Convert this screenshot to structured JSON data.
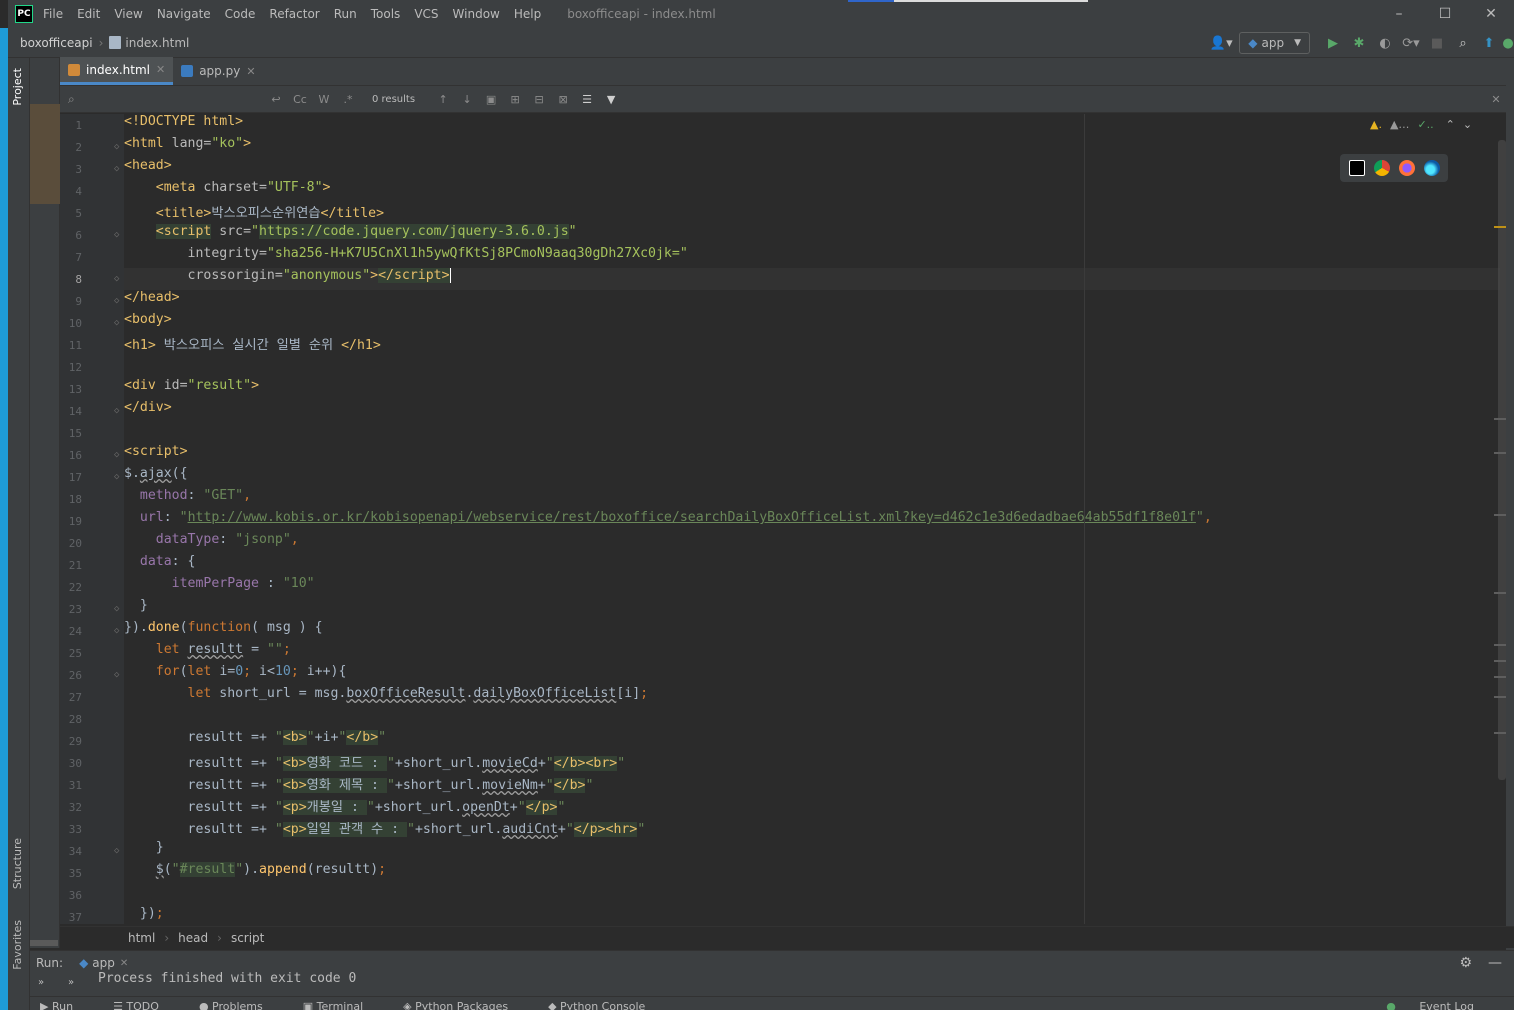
{
  "titlebar": {
    "logo": "PC",
    "menu": [
      "File",
      "Edit",
      "View",
      "Navigate",
      "Code",
      "Refactor",
      "Run",
      "Tools",
      "VCS",
      "Window",
      "Help"
    ],
    "window_title": "boxofficeapi - index.html",
    "controls": [
      "–",
      "☐",
      "✕"
    ]
  },
  "navbar": {
    "project": "boxofficeapi",
    "file": "index.html",
    "run_config": "app"
  },
  "left_tabs": {
    "project": "Project",
    "structure": "Structure",
    "favorites": "Favorites"
  },
  "tabs": [
    {
      "label": "index.html",
      "active": true
    },
    {
      "label": "app.py",
      "active": false
    }
  ],
  "findbar": {
    "placeholder": "",
    "case_label": "Cc",
    "word_label": "W",
    "regex_label": ".*",
    "results": "0 results"
  },
  "editor": {
    "line_numbers": [
      "1",
      "2",
      "3",
      "4",
      "5",
      "6",
      "7",
      "8",
      "9",
      "10",
      "11",
      "12",
      "13",
      "14",
      "15",
      "16",
      "17",
      "18",
      "19",
      "20",
      "21",
      "22",
      "23",
      "24",
      "25",
      "26",
      "27",
      "28",
      "29",
      "30",
      "31",
      "32",
      "33",
      "34",
      "35",
      "36",
      "37"
    ],
    "current_line": 8,
    "inspection": {
      "warnings_a": "▲.",
      "warnings_b": "▲…",
      "ok": "✓.."
    }
  },
  "code_text": {
    "l11_text": " 박스오피스 실시간 일별 순위 ",
    "l5_title": "박스오피스순위연습",
    "script_url": "https://code.jquery.com/jquery-3.6.0.js",
    "integrity": "sha256-H+K7U5CnXl1h5ywQfKtSj8PCmoN9aaq30gDh27Xc0jk=",
    "api_url": "http://www.kobis.or.kr/kobisopenapi/webservice/rest/boxoffice/searchDailyBoxOfficeList.xml?key=d462c1e3d6edadbae64ab55df1f8e01f",
    "label_code": "영화 코드 : ",
    "label_title": "영화 제목 : ",
    "label_open": "개봉일 : ",
    "label_audi": "일일 관객 수 : "
  },
  "editor_crumbs": [
    "html",
    "head",
    "script"
  ],
  "run_panel": {
    "label": "Run:",
    "tab": "app",
    "output": "Process finished with exit code 0"
  },
  "bottom_tools": [
    "Run",
    "TODO",
    "Problems",
    "Terminal",
    "Python Packages",
    "Python Console",
    "Event Log"
  ],
  "colors": {
    "background": "#2b2b2b",
    "panel": "#3c3f41",
    "accent": "#1e9bd7",
    "tag": "#e8bf6a",
    "keyword": "#cc7832",
    "string": "#6a8759"
  }
}
